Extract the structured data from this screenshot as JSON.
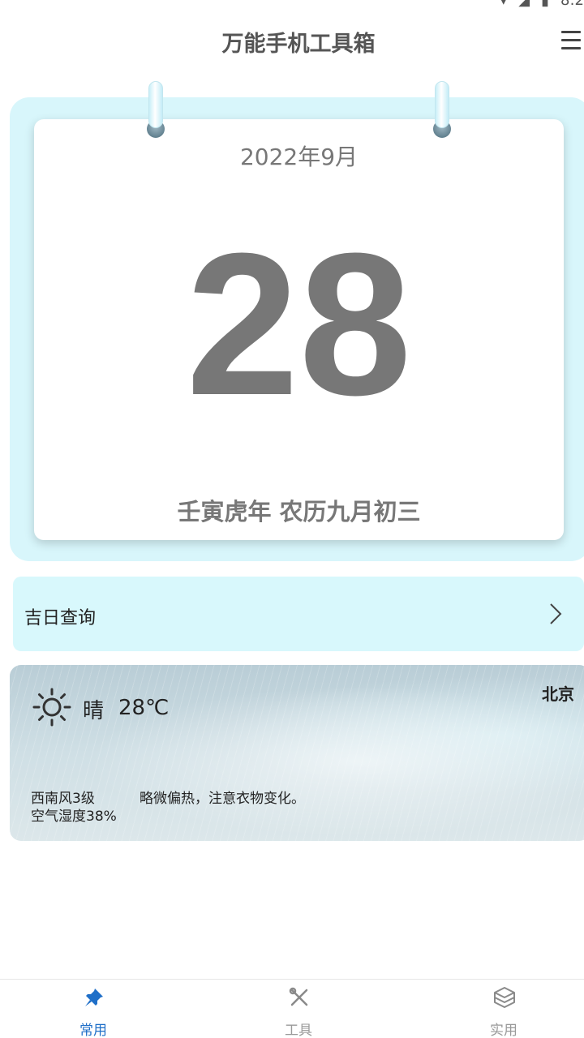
{
  "status_bar": {
    "time": "8:2"
  },
  "header": {
    "title": "万能手机工具箱",
    "menu_icon": "hamburger-menu-icon"
  },
  "calendar": {
    "month": "2022年9月",
    "day": "28",
    "lunar": "壬寅虎年 农历九月初三"
  },
  "lucky_day": {
    "label": "吉日查询",
    "icon": "chevron-right-icon"
  },
  "weather": {
    "icon": "sun-icon",
    "condition": "晴",
    "temperature": "28℃",
    "city": "北京",
    "wind": "西南风3级",
    "humidity": "空气湿度38%",
    "advice": "略微偏热，注意衣物变化。"
  },
  "bottom_nav": {
    "items": [
      {
        "label": "常用",
        "icon": "pin-icon",
        "active": true
      },
      {
        "label": "工具",
        "icon": "tools-icon",
        "active": false
      },
      {
        "label": "实用",
        "icon": "cube-icon",
        "active": false
      }
    ],
    "active_color": "#1f6fc8",
    "inactive_color": "#9a9a9a"
  },
  "colors": {
    "calendar_bg": "#d8f6fb",
    "lucky_bg": "#d8f8fc",
    "day_text": "#777777"
  }
}
